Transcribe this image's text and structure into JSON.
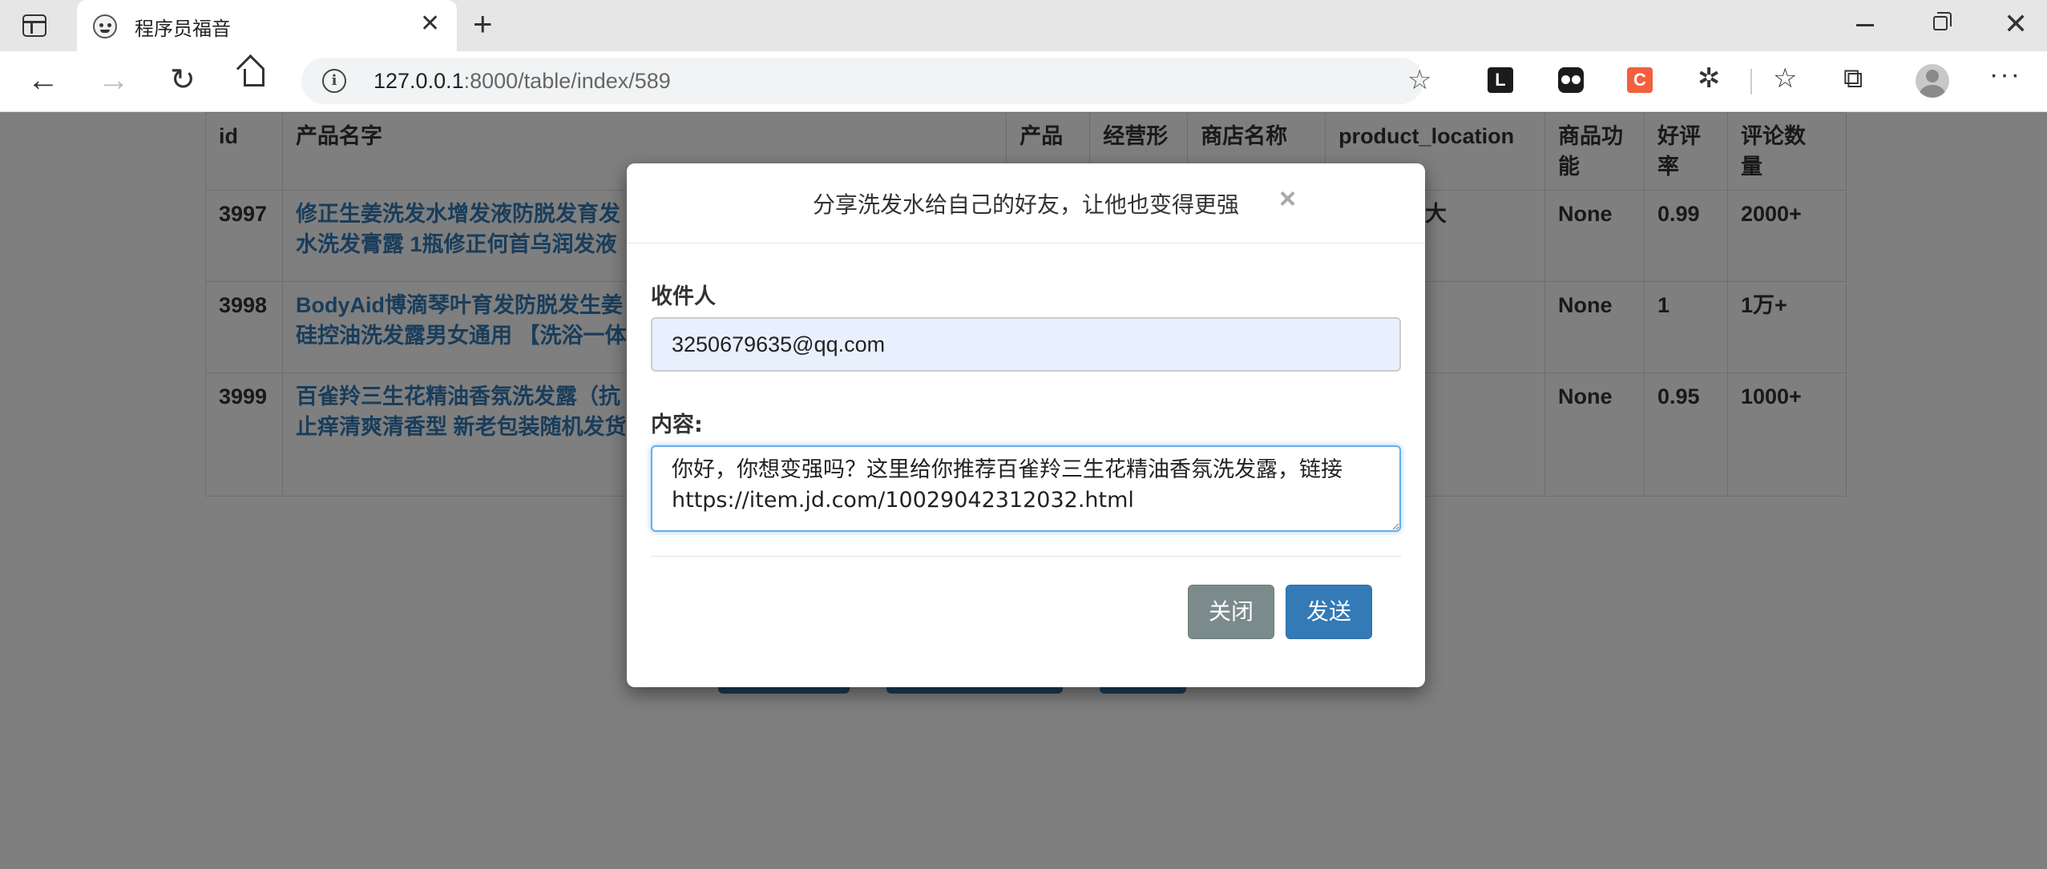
{
  "browser": {
    "tab_title": "程序员福音",
    "tab_close": "✕",
    "new_tab": "+",
    "url_host": "127.0.0.1",
    "url_path": ":8000/table/index/589",
    "info": "i",
    "ext_1_label": "L",
    "ext_3_label": "C"
  },
  "table": {
    "headers": [
      "id",
      "产品名字",
      "产品",
      "经营形",
      "商店名称",
      "product_location",
      "商品功\n能",
      "好评\n率",
      "评论数\n量"
    ],
    "rows": [
      {
        "id": "3997",
        "name": "修正生姜洗发水增发液防脱发育发\n水洗发膏露 1瓶修正何首乌润发液",
        "product": "",
        "biz": "",
        "shop": "",
        "location": "地：中国大",
        "func": "None",
        "rate": "0.99",
        "comments": "2000+"
      },
      {
        "id": "3998",
        "name": "BodyAid博滴琴叶育发防脱发生姜\n硅控油洗发露男女通用 【洗浴一体",
        "product": "",
        "biz": "",
        "shop": "",
        "location": "",
        "func": "None",
        "rate": "1",
        "comments": "1万+"
      },
      {
        "id": "3999",
        "name": "百雀羚三生花精油香氛洗发露（抗\n止痒清爽清香型 新老包装随机发货",
        "product": "",
        "biz": "",
        "shop": "",
        "location": "",
        "func": "None",
        "rate": "0.95",
        "comments": "1000+"
      }
    ]
  },
  "modal": {
    "title": "分享洗发水给自己的好友，让他也变得更强",
    "close_glyph": "×",
    "recipient_label": "收件人",
    "recipient_value": "3250679635@qq.com",
    "content_label": "内容:",
    "content_value": "你好，你想变强吗？这里给你推荐百雀羚三生花精油香氛洗发露，链接\nhttps://item.jd.com/10029042312032.html",
    "close_button": "关闭",
    "send_button": "发送"
  }
}
